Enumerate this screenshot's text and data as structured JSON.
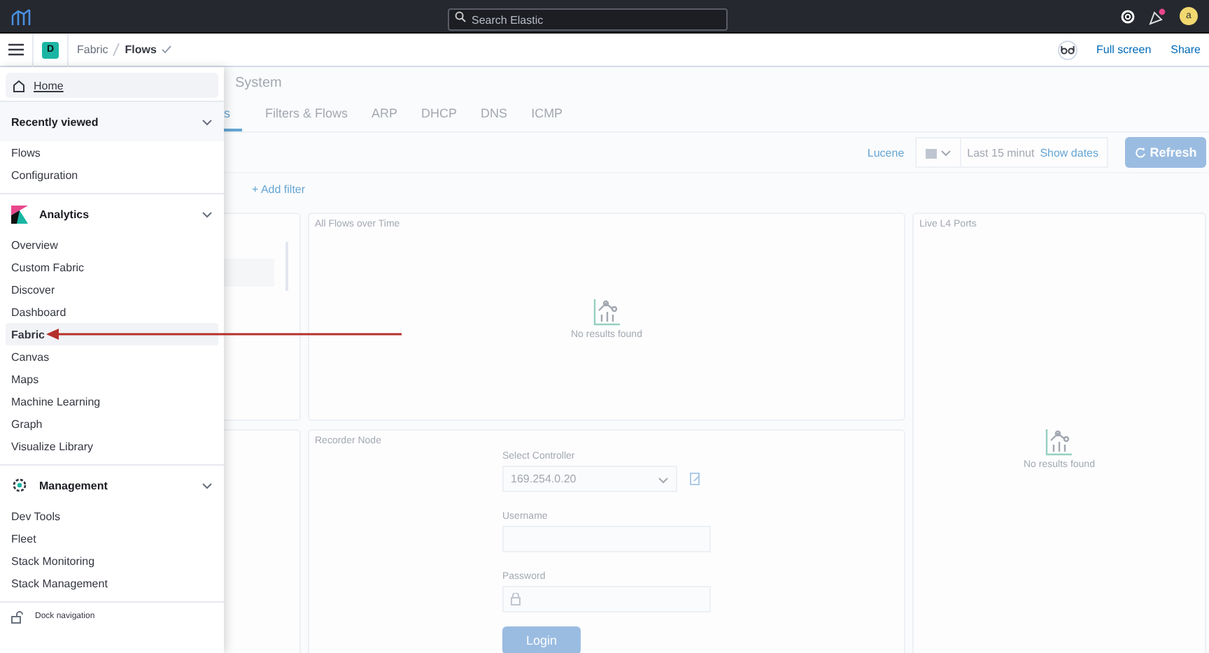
{
  "top_bar": {
    "search": {
      "placeholder": "Search Elastic"
    },
    "avatar": "a"
  },
  "header": {
    "space": "D",
    "breadcrumbs": [
      {
        "label": "Fabric",
        "current": false
      },
      {
        "label": "Flows",
        "current": true
      }
    ],
    "links": [
      "Full screen",
      "Share"
    ]
  },
  "app": {
    "page_title": "System",
    "tabs": [
      {
        "label": "s",
        "selected": true
      },
      {
        "label": "Filters & Flows",
        "selected": false
      },
      {
        "label": "ARP",
        "selected": false
      },
      {
        "label": "DHCP",
        "selected": false
      },
      {
        "label": "DNS",
        "selected": false
      },
      {
        "label": "ICMP",
        "selected": false
      }
    ],
    "query": {
      "language": "Lucene",
      "time": "Last 15 minut",
      "show_dates": "Show dates",
      "refresh": "Refresh"
    },
    "add_filter": "+ Add filter",
    "flows_panel": {
      "title": "All Flows over Time",
      "empty": "No results found"
    },
    "recorder_panel": {
      "title": "Recorder Node",
      "controller_label": "Select Controller",
      "controller_value": "169.254.0.20",
      "username_label": "Username",
      "password_label": "Password",
      "login": "Login"
    },
    "ports_panel": {
      "title": "Live L4 Ports",
      "empty": "No results found"
    }
  },
  "nav": {
    "home": "Home",
    "groups": [
      {
        "title": "Recently viewed",
        "kind": "recent",
        "expanded": true,
        "items": [
          {
            "label": "Flows",
            "selected": false
          },
          {
            "label": "Configuration",
            "selected": false
          }
        ]
      },
      {
        "title": "Analytics",
        "kind": "analytics",
        "expanded": true,
        "items": [
          {
            "label": "Overview",
            "selected": false
          },
          {
            "label": "Custom Fabric",
            "selected": false
          },
          {
            "label": "Discover",
            "selected": false
          },
          {
            "label": "Dashboard",
            "selected": false
          },
          {
            "label": "Fabric",
            "selected": true
          },
          {
            "label": "Canvas",
            "selected": false
          },
          {
            "label": "Maps",
            "selected": false
          },
          {
            "label": "Machine Learning",
            "selected": false
          },
          {
            "label": "Graph",
            "selected": false
          },
          {
            "label": "Visualize Library",
            "selected": false
          }
        ]
      },
      {
        "title": "Management",
        "kind": "management",
        "expanded": true,
        "items": [
          {
            "label": "Dev Tools",
            "selected": false
          },
          {
            "label": "Fleet",
            "selected": false
          },
          {
            "label": "Stack Monitoring",
            "selected": false
          },
          {
            "label": "Stack Management",
            "selected": false
          }
        ]
      }
    ],
    "dock": "Dock navigation"
  }
}
